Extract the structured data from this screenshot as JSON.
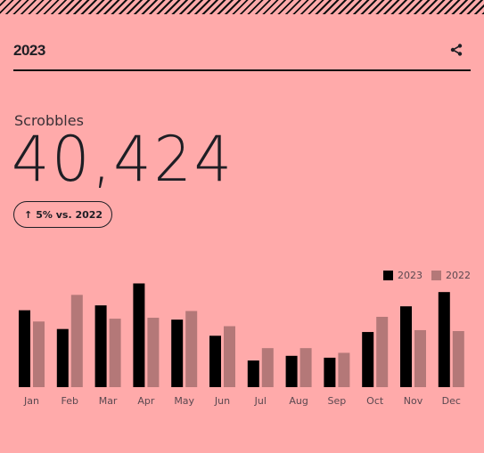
{
  "header": {
    "title": "2023",
    "share_icon": "share-icon"
  },
  "metric": {
    "label": "Scrobbles",
    "value": "40,424",
    "change": {
      "icon": "arrow-up-icon",
      "arrow": "↑",
      "text": "5% vs. 2022"
    }
  },
  "colors": {
    "background": "#ffaaaa",
    "series_2023": "#000000",
    "series_2022": "#b47878"
  },
  "chart_data": {
    "type": "bar",
    "title": "",
    "xlabel": "",
    "ylabel": "",
    "grid": false,
    "legend_position": "top-right",
    "categories": [
      "Jan",
      "Feb",
      "Mar",
      "Apr",
      "May",
      "Jun",
      "Jul",
      "Aug",
      "Sep",
      "Oct",
      "Nov",
      "Dec"
    ],
    "series": [
      {
        "name": "2023",
        "color": "#000000",
        "values": [
          4100,
          3100,
          4360,
          5530,
          3600,
          2740,
          1420,
          1670,
          1570,
          2940,
          4310,
          5070
        ]
      },
      {
        "name": "2022",
        "color": "#b47878",
        "values": [
          3500,
          4920,
          3650,
          3700,
          4060,
          3250,
          2080,
          2080,
          1830,
          3750,
          3040,
          2990
        ]
      }
    ],
    "ylim": [
      0,
      5600
    ]
  }
}
